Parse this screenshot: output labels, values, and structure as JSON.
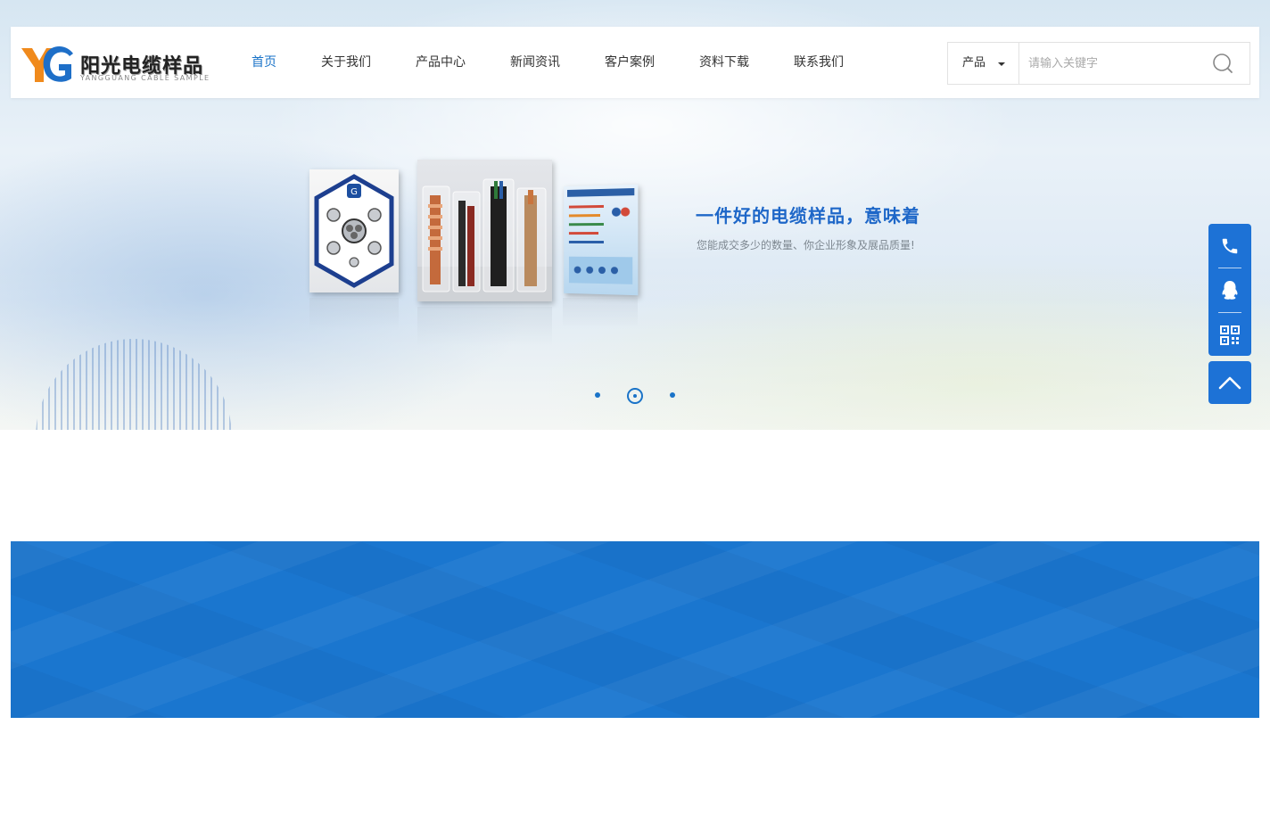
{
  "logo": {
    "mark": "YG",
    "name_cn": "阳光电缆样品",
    "name_en": "YANGGUANG CABLE SAMPLE"
  },
  "nav": {
    "items": [
      {
        "label": "首页",
        "active": true
      },
      {
        "label": "关于我们"
      },
      {
        "label": "产品中心"
      },
      {
        "label": "新闻资讯"
      },
      {
        "label": "客户案例"
      },
      {
        "label": "资料下载"
      },
      {
        "label": "联系我们"
      }
    ]
  },
  "search": {
    "type_selected": "产品",
    "placeholder": "请输入关键字"
  },
  "banner": {
    "headline": "一件好的电缆样品，意味着",
    "subline": "您能成交多少的数量、你企业形象及展品质量!",
    "slides_total": 3,
    "active_slide": 2
  },
  "side_bar": {
    "icons": [
      "phone-icon",
      "qq-icon",
      "qrcode-icon"
    ],
    "back_to_top_icon": "chevron-up-icon"
  },
  "colors": {
    "accent": "#1a73c8",
    "side_bar": "#1d72d6",
    "band": "#1a76cf"
  }
}
